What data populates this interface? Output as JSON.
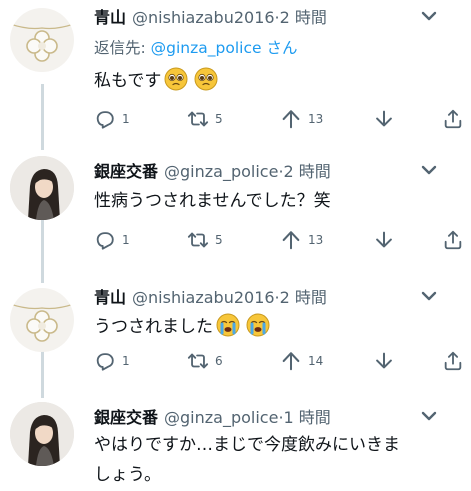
{
  "tweets": [
    {
      "name": "青山",
      "handle": "@nishiazabu2016",
      "dot": "·",
      "time": "2 時間",
      "reply_prefix": "返信先: ",
      "reply_handle": "@ginza_police",
      "reply_suffix": " さん",
      "text": "私もです",
      "emoji": [
        "pleading-face",
        "pleading-face"
      ],
      "replies": "1",
      "retweets": "5",
      "likes": "13"
    },
    {
      "name": "銀座交番",
      "handle": "@ginza_police",
      "dot": "·",
      "time": "2 時間",
      "text": "性病うつされませんでした？笑",
      "replies": "1",
      "retweets": "5",
      "likes": "13"
    },
    {
      "name": "青山",
      "handle": "@nishiazabu2016",
      "dot": "·",
      "time": "2 時間",
      "text": "うつされました",
      "emoji": [
        "crying-face",
        "crying-face"
      ],
      "replies": "1",
      "retweets": "6",
      "likes": "14"
    },
    {
      "name": "銀座交番",
      "handle": "@ginza_police",
      "dot": "·",
      "time": "1 時間",
      "text_line1": "やはりですか…まじで今度飲みにいきま",
      "text_line2": "しょう。"
    }
  ],
  "colors": {
    "text": "#0f1419",
    "secondary": "#536471",
    "link": "#1d9bf0",
    "thread_line": "#cfd9de"
  },
  "icons": [
    "reply-icon",
    "retweet-icon",
    "like-icon",
    "download-icon",
    "share-icon",
    "more-icon"
  ]
}
